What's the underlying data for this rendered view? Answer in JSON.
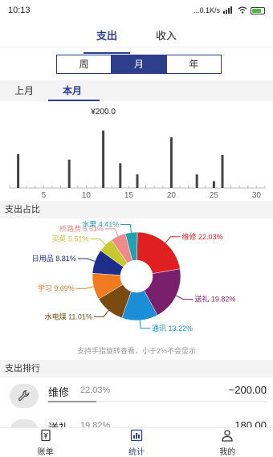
{
  "status_bar": {
    "time": "10:13",
    "network_speed": "...0.1K/s",
    "signal": "4G",
    "battery_level": 0.75
  },
  "type_tabs": [
    {
      "label": "支出",
      "active": true
    },
    {
      "label": "收入",
      "active": false
    }
  ],
  "period_tabs": [
    {
      "label": "周",
      "active": false
    },
    {
      "label": "月",
      "active": true
    },
    {
      "label": "年",
      "active": false
    }
  ],
  "month_tabs": [
    {
      "label": "上月",
      "active": false
    },
    {
      "label": "本月",
      "active": true
    }
  ],
  "chart_data": [
    {
      "type": "bar",
      "max_label": "¥200.0",
      "x": [
        2,
        8,
        12,
        14,
        16,
        20,
        23,
        25,
        26
      ],
      "values": [
        100,
        84,
        170,
        73,
        40,
        150,
        40,
        20,
        98
      ],
      "x_ticks": [
        "5",
        "10",
        "15",
        "20",
        "25",
        "30"
      ],
      "xlim": [
        1,
        31
      ],
      "ylim": [
        0,
        200
      ],
      "bar_color": "#444444"
    },
    {
      "type": "pie",
      "style": "donut",
      "slices": [
        {
          "label": "维修 22.03%",
          "value": 22.03,
          "color": "#e02020"
        },
        {
          "label": "送礼 19.82%",
          "value": 19.82,
          "color": "#7a1f6b"
        },
        {
          "label": "通讯 13.22%",
          "value": 13.22,
          "color": "#1a8fd8"
        },
        {
          "label": "水电煤 11.01%",
          "value": 11.01,
          "color": "#7a4a10"
        },
        {
          "label": "学习 9.69%",
          "value": 9.69,
          "color": "#f07a20"
        },
        {
          "label": "日用品 8.81%",
          "value": 8.81,
          "color": "#1c2e8a"
        },
        {
          "label": "买菜 5.51%",
          "value": 5.51,
          "color": "#c8c832"
        },
        {
          "label": "桥路费 5.51%",
          "value": 5.51,
          "color": "#f08a8a"
        },
        {
          "label": "水果 4.41%",
          "value": 4.41,
          "color": "#22a0b0"
        }
      ]
    }
  ],
  "pie_section": {
    "title": "支出占比",
    "hint": "支持手指旋转查看，小于2%不会显示"
  },
  "ranking": {
    "title": "支出排行",
    "items": [
      {
        "name": "维修",
        "percent": "22.03%",
        "amount": "−200.00",
        "icon": "wrench-icon",
        "fill": 0.22
      },
      {
        "name": "送礼",
        "percent": "19.82%",
        "amount": "180.00",
        "icon": "gift-icon",
        "fill": 0.2
      }
    ]
  },
  "bottom_nav": [
    {
      "label": "账单",
      "icon": "receipt-icon",
      "active": false
    },
    {
      "label": "统计",
      "icon": "chart-icon",
      "active": true
    },
    {
      "label": "我的",
      "icon": "profile-icon",
      "active": false
    }
  ]
}
